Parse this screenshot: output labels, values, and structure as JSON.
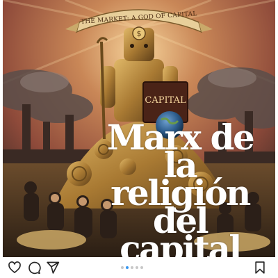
{
  "post": {
    "image": {
      "banner_text": "THE MARKET: A GOD OF CAPITAL",
      "book_text": "CAPITAL",
      "headline_lines": [
        "Marx de",
        "la",
        "religión",
        "del",
        "capital"
      ]
    },
    "actions": {
      "like_icon": "heart-icon",
      "comment_icon": "comment-icon",
      "share_icon": "send-icon",
      "save_icon": "bookmark-icon"
    },
    "carousel": {
      "total": 5,
      "active_index": 1
    },
    "colors": {
      "active_dot": "#3897f0",
      "inactive_dot": "#c7c7c7",
      "headline": "#ffffff",
      "sky": "#8e4a3a",
      "gold": "#b8863b"
    }
  }
}
